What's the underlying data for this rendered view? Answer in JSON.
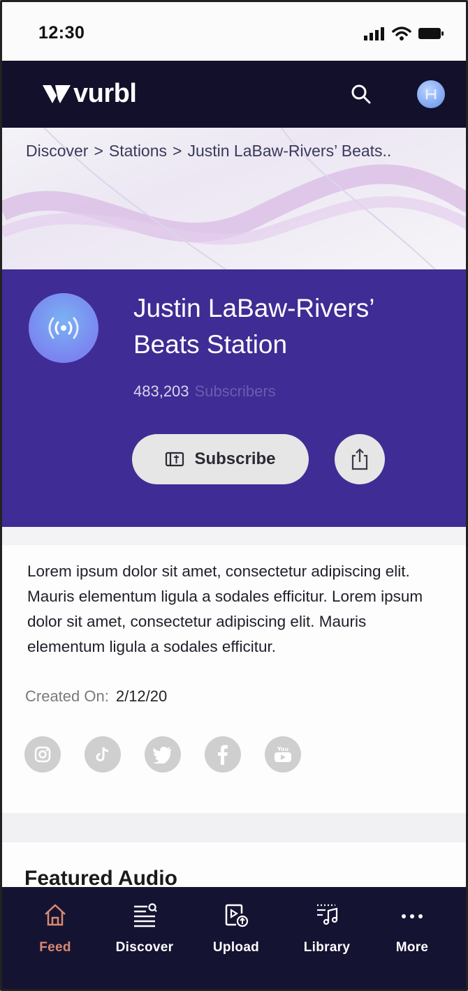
{
  "status_bar": {
    "time": "12:30",
    "icons": [
      "signal-icon",
      "wifi-icon",
      "battery-icon"
    ]
  },
  "header": {
    "logo_text": "vurbl",
    "search_icon": "search-icon",
    "avatar_icon": "user-avatar"
  },
  "breadcrumb": {
    "items": [
      "Discover",
      "Stations",
      "Justin LaBaw-Rivers’ Beats.."
    ],
    "separator": ">"
  },
  "station": {
    "title_line1": "Justin LaBaw-Rivers’",
    "title_line2": "Beats Station",
    "subscriber_count": "483,203",
    "subscriber_label": "Subscribers",
    "subscribe_label": "Subscribe",
    "icon": "broadcast-icon",
    "share_icon": "share-icon"
  },
  "about": {
    "description": "Lorem ipsum dolor sit amet, consectetur adipiscing elit. Mauris elementum ligula a sodales efficitur. Lorem ipsum dolor sit amet, consectetur adipiscing elit. Mauris elementum ligula a sodales efficitur.",
    "created_label": "Created On:",
    "created_value": "2/12/20",
    "socials": [
      "instagram-icon",
      "tiktok-icon",
      "twitter-icon",
      "facebook-icon",
      "youtube-icon"
    ]
  },
  "featured": {
    "heading": "Featured Audio"
  },
  "tabbar": {
    "tabs": [
      {
        "label": "Feed",
        "icon": "home-icon",
        "active": true
      },
      {
        "label": "Discover",
        "icon": "discover-icon",
        "active": false
      },
      {
        "label": "Upload",
        "icon": "upload-icon",
        "active": false
      },
      {
        "label": "Library",
        "icon": "library-icon",
        "active": false
      },
      {
        "label": "More",
        "icon": "more-icon",
        "active": false
      }
    ]
  },
  "colors": {
    "appbar": "#12102a",
    "station_bg": "#3f2c94",
    "tabbar": "#151332",
    "active_tab": "#d88a72"
  }
}
